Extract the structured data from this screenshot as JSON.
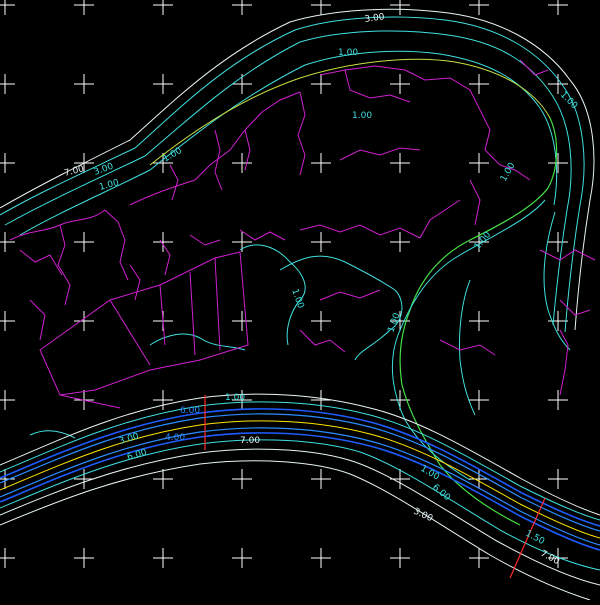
{
  "view": {
    "background": "#000000",
    "grid_color": "#ffffff"
  },
  "colors": {
    "contour_cyan": "#3fe0e0",
    "contour_white": "#e8f4f4",
    "channel_blue": "#1e5cff",
    "channel_mid": "#2a8cff",
    "centerline_yellow": "#ffe600",
    "route_green": "#44e044",
    "drainage_magenta": "#d020d0",
    "section_red": "#ff2a2a"
  },
  "labels": {
    "top_3": "3.00",
    "top_1": "1.00",
    "upper_left_7": "7.00",
    "upper_left_3": "3.00",
    "upper_left_1": "1.00",
    "mid_100": "1.00",
    "right_top_1": "1.00",
    "right_mid_1": "1.00",
    "right_inner_1": "1.00",
    "left_green_1": "1.00",
    "inner_left_1": "1.00",
    "channel_1": "1.00",
    "channel_6": "6.00",
    "channel_4": "4.00",
    "channel_1b": "1.00",
    "channel_7": "7.00",
    "channel_3": "3.00",
    "channel_6b": "6.00",
    "lower_right_100": "1.00",
    "lower_right_600": "6.00",
    "lower_right_300": "3.00",
    "lower_right_150": "1.50",
    "lower_right_7": "7.00"
  }
}
